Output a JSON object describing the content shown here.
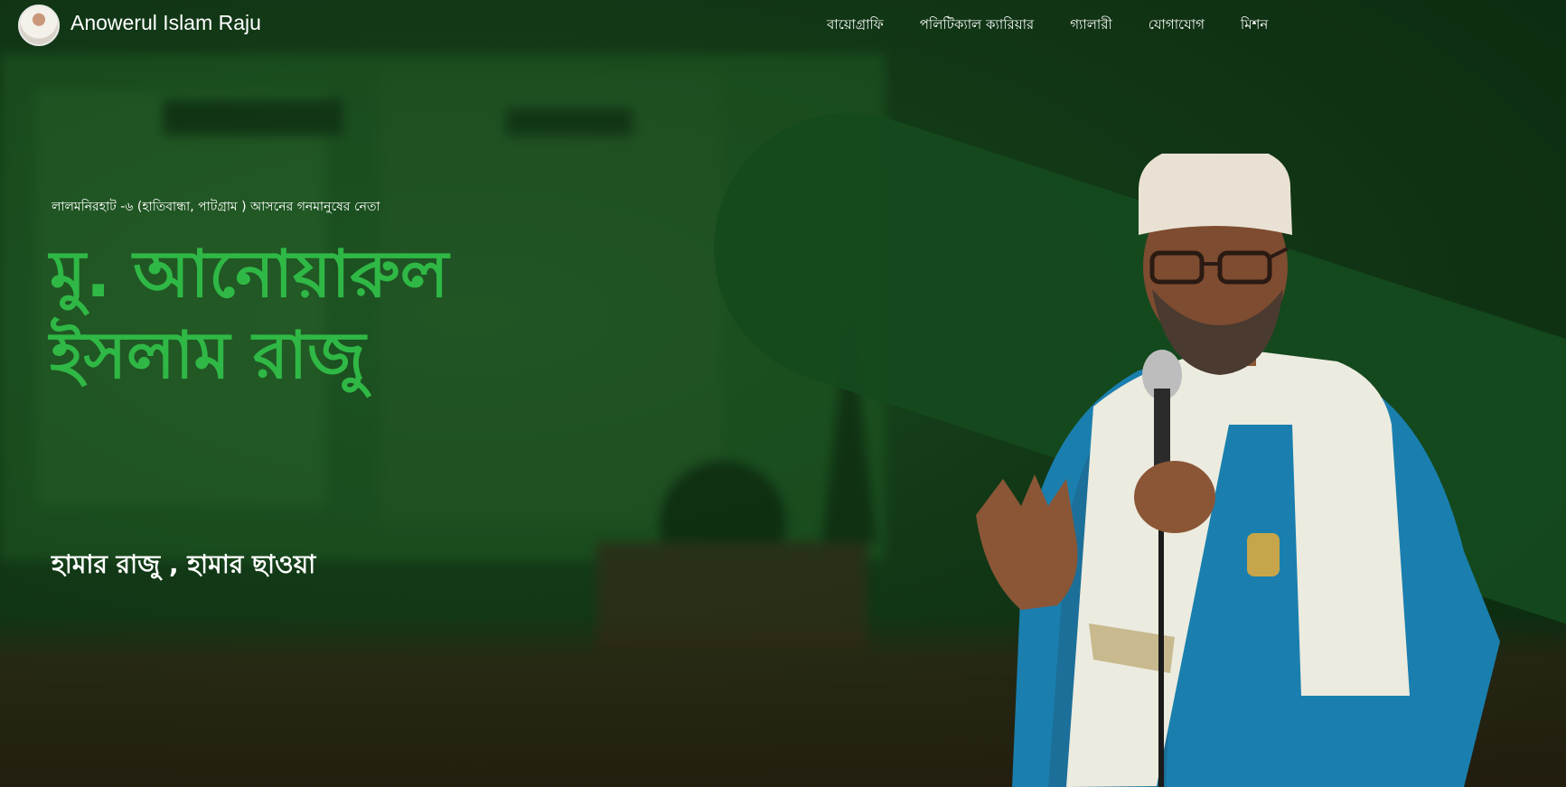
{
  "header": {
    "site_name": "Anowerul Islam Raju",
    "logo_icon": "avatar-icon"
  },
  "nav": {
    "items": [
      {
        "label": "বায়োগ্রাফি"
      },
      {
        "label": "পলিটিক্যাল ক্যারিয়ার"
      },
      {
        "label": "গ্যালারী"
      },
      {
        "label": "যোগাযোগ"
      },
      {
        "label": "মিশন"
      }
    ]
  },
  "hero": {
    "tagline": "লালমনিরহাট -৬ (হাতিবান্ধা, পাটগ্রাম ) আসনের গনমানুষের নেতা",
    "name": "মু. আনোয়ারুল ইসলাম রাজু",
    "slogan": "হামার রাজু , হামার ছাওয়া"
  },
  "colors": {
    "accent_green": "#2fb845",
    "background_green": "#123816",
    "shape_green": "#154a1d",
    "text_white": "#ffffff"
  }
}
